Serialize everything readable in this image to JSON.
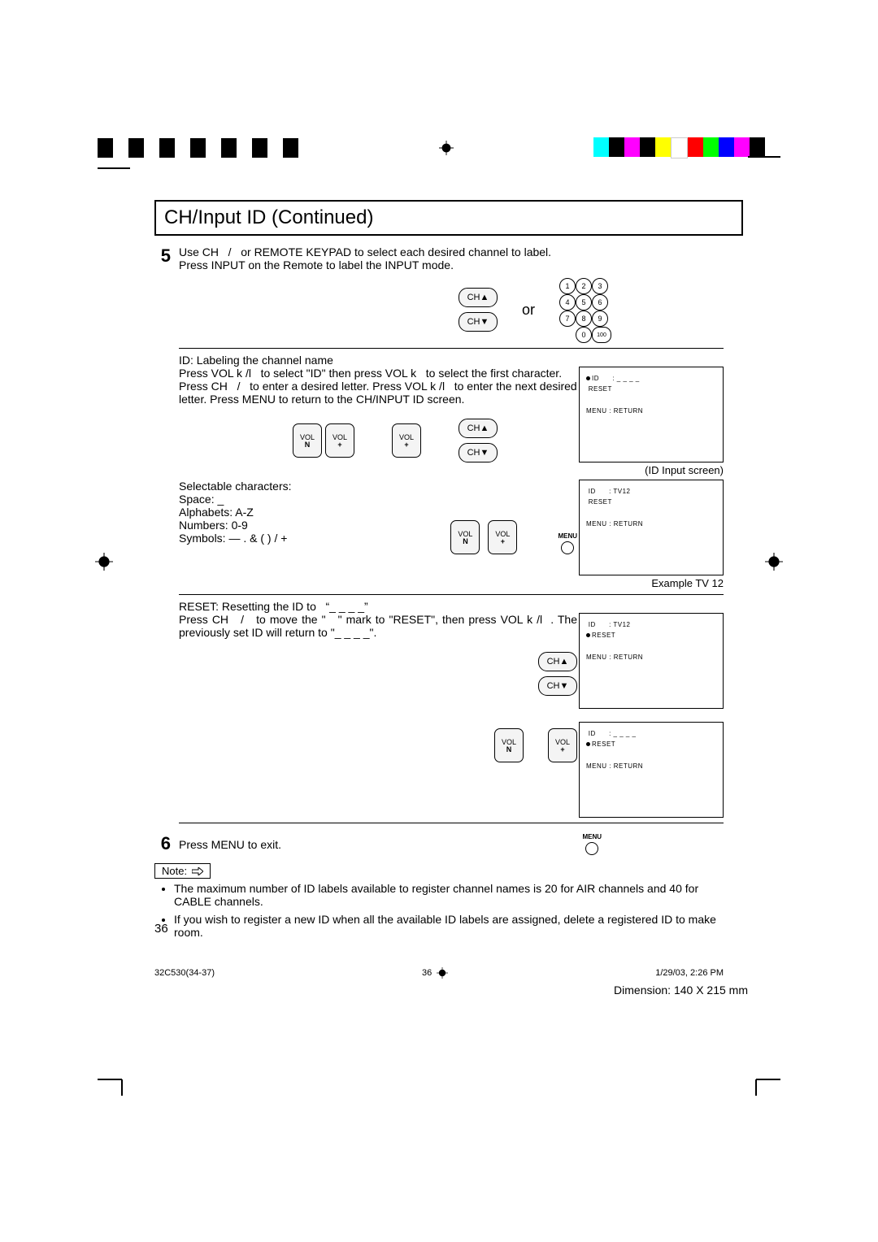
{
  "title": "CH/Input ID (Continued)",
  "step5": {
    "num": "5",
    "text1": "Use CH   /   or REMOTE KEYPAD to select each desired channel to label.",
    "text2": "Press INPUT on the Remote to label the INPUT mode.",
    "or": "or",
    "ch_up": "CH▲",
    "ch_dn": "CH▼",
    "keypad": [
      "1",
      "2",
      "3",
      "4",
      "5",
      "6",
      "7",
      "8",
      "9",
      "0",
      "100"
    ]
  },
  "id_section": {
    "heading": "ID: Labeling the channel name",
    "para": "Press VOL k /l   to select \"ID\" then press  VOL k   to select the first character. Press CH   /   to enter a desired letter. Press VOL k /l   to enter the next desired letter. Press MENU to return to the CH/INPUT ID screen.",
    "vol_n": "VOL",
    "vol_n_sub": "N",
    "vol_p": "VOL",
    "vol_p_sub": "+",
    "screen_lines": [
      "ID      : _ _ _ _",
      "RESET",
      "",
      "MENU : RETURN"
    ],
    "screen_caption": "(ID Input screen)"
  },
  "selectable": {
    "l1": "Selectable characters:",
    "l2": "Space: _",
    "l3": "Alphabets: A-Z",
    "l4": "Numbers: 0-9",
    "l5": "Symbols: —   .   &   (   )   /   +",
    "screen_lines": [
      "ID      : TV12",
      "RESET",
      "",
      "MENU : RETURN"
    ],
    "screen_caption": "Example TV 12",
    "menu_label": "MENU"
  },
  "reset": {
    "heading": "RESET: Resetting the ID to   “_ _ _ _”",
    "para": "Press CH   /   to move the \"   \" mark to \"RESET\", then press VOL k /l  . The previously set ID will return to \"_ _ _ _\".",
    "screenA_lines": [
      "ID      : TV12",
      "RESET",
      "",
      "MENU : RETURN"
    ],
    "screenB_lines": [
      "ID      : _ _ _ _",
      "RESET",
      "",
      "MENU : RETURN"
    ]
  },
  "step6": {
    "num": "6",
    "text": "Press MENU to exit.",
    "menu_label": "MENU"
  },
  "note": {
    "label": "Note:",
    "bullets": [
      "The maximum number of ID labels available to register channel names is 20 for AIR channels and 40 for CABLE channels.",
      "If you wish to register a new ID when all the available ID labels are assigned, delete a registered ID to make room."
    ]
  },
  "page_number": "36",
  "footer": {
    "left": "32C530(34-37)",
    "mid": "36",
    "right": "1/29/03, 2:26 PM"
  },
  "dimension": "Dimension: 140  X  215 mm"
}
